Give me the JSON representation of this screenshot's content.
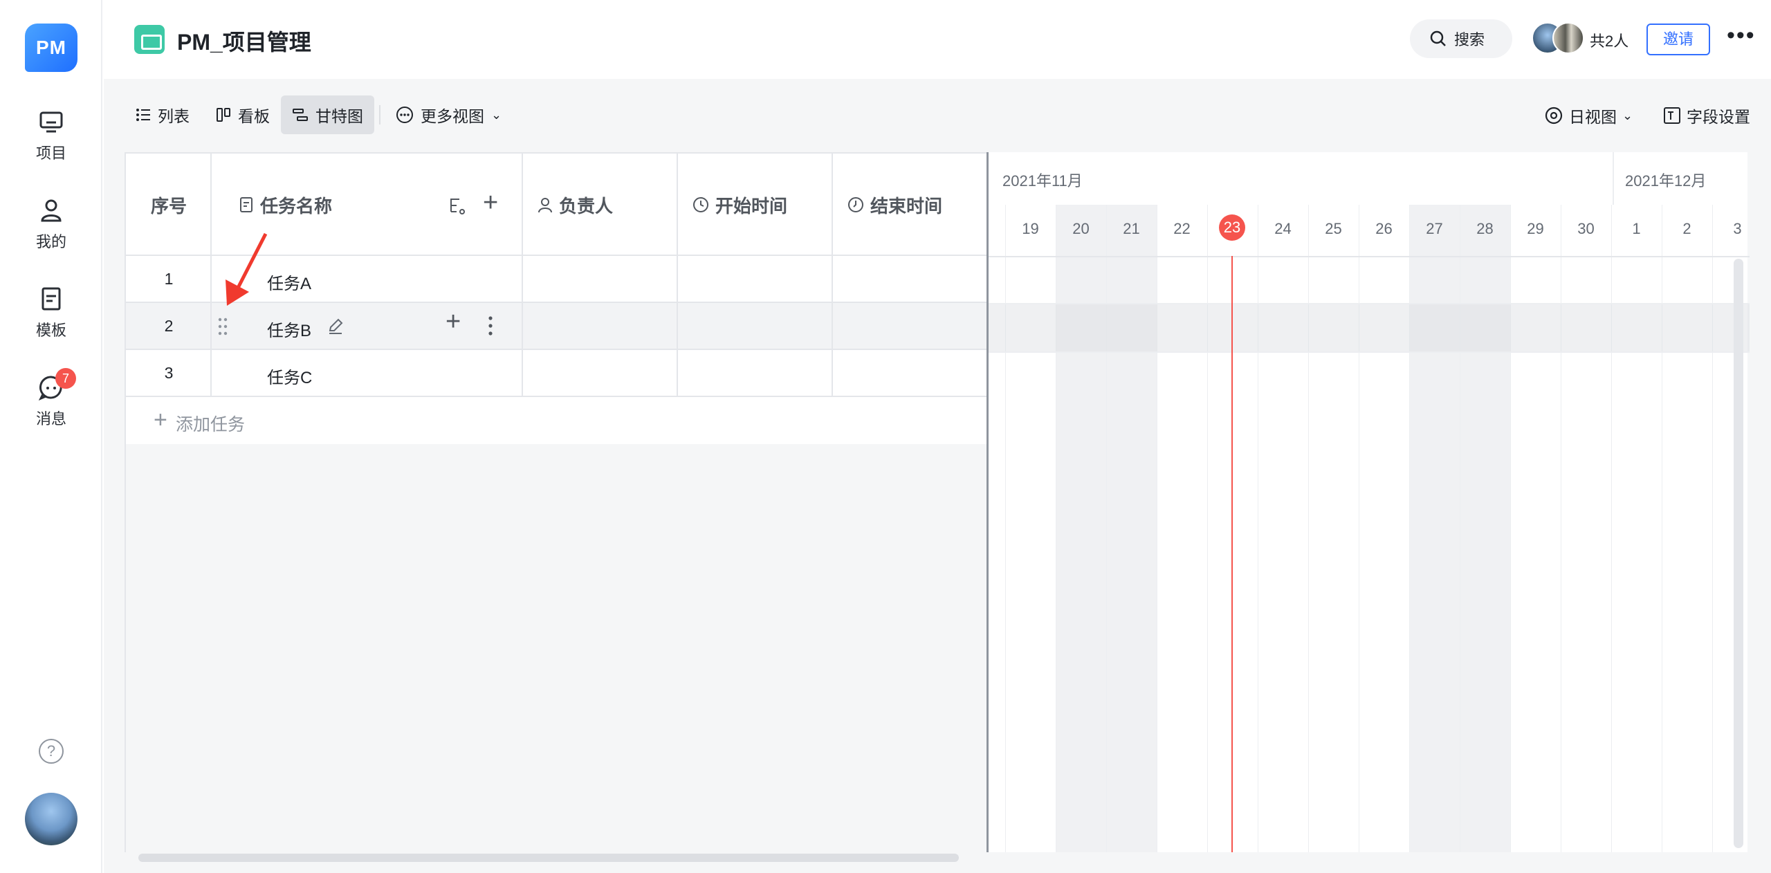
{
  "app": {
    "logo_text": "PM"
  },
  "sidebar": {
    "items": [
      {
        "label": "项目",
        "icon": "monitor-icon"
      },
      {
        "label": "我的",
        "icon": "user-icon"
      },
      {
        "label": "模板",
        "icon": "document-icon"
      },
      {
        "label": "消息",
        "icon": "chat-icon",
        "badge": "7"
      }
    ],
    "help_icon": "?"
  },
  "header": {
    "project_title": "PM_项目管理",
    "search_label": "搜索",
    "members_label": "共2人",
    "invite_label": "邀请",
    "more_label": "•••"
  },
  "toolbar": {
    "tabs": [
      {
        "label": "列表",
        "icon": "list-icon",
        "active": false
      },
      {
        "label": "看板",
        "icon": "kanban-icon",
        "active": false
      },
      {
        "label": "甘特图",
        "icon": "gantt-icon",
        "active": true
      },
      {
        "label": "更多视图",
        "icon": "more-circle-icon",
        "active": false
      }
    ],
    "day_view_label": "日视图",
    "field_settings_label": "字段设置"
  },
  "table": {
    "columns": [
      "序号",
      "任务名称",
      "负责人",
      "开始时间",
      "结束时间"
    ],
    "rows": [
      {
        "index": "1",
        "name": "任务A"
      },
      {
        "index": "2",
        "name": "任务B"
      },
      {
        "index": "3",
        "name": "任务C"
      }
    ],
    "add_task_label": "添加任务"
  },
  "gantt": {
    "months": [
      "2021年11月",
      "2021年12月"
    ],
    "days": [
      "19",
      "20",
      "21",
      "22",
      "23",
      "24",
      "25",
      "26",
      "27",
      "28",
      "29",
      "30",
      "1",
      "2",
      "3"
    ],
    "today": "23",
    "colors": {
      "today": "#f5544d",
      "accent": "#3370ff"
    }
  }
}
